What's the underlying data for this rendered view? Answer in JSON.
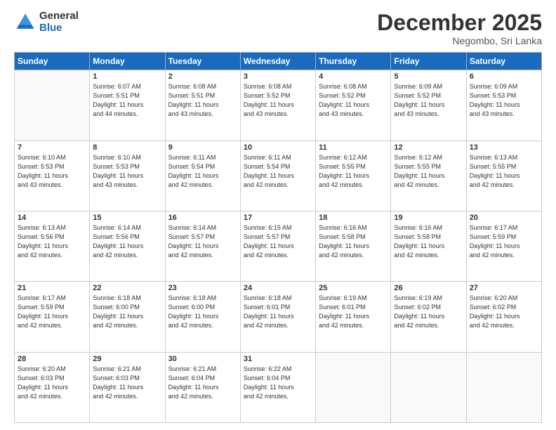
{
  "logo": {
    "general": "General",
    "blue": "Blue"
  },
  "title": "December 2025",
  "location": "Negombo, Sri Lanka",
  "days_of_week": [
    "Sunday",
    "Monday",
    "Tuesday",
    "Wednesday",
    "Thursday",
    "Friday",
    "Saturday"
  ],
  "weeks": [
    [
      {
        "day": "",
        "info": ""
      },
      {
        "day": "1",
        "info": "Sunrise: 6:07 AM\nSunset: 5:51 PM\nDaylight: 11 hours\nand 44 minutes."
      },
      {
        "day": "2",
        "info": "Sunrise: 6:08 AM\nSunset: 5:51 PM\nDaylight: 11 hours\nand 43 minutes."
      },
      {
        "day": "3",
        "info": "Sunrise: 6:08 AM\nSunset: 5:52 PM\nDaylight: 11 hours\nand 43 minutes."
      },
      {
        "day": "4",
        "info": "Sunrise: 6:08 AM\nSunset: 5:52 PM\nDaylight: 11 hours\nand 43 minutes."
      },
      {
        "day": "5",
        "info": "Sunrise: 6:09 AM\nSunset: 5:52 PM\nDaylight: 11 hours\nand 43 minutes."
      },
      {
        "day": "6",
        "info": "Sunrise: 6:09 AM\nSunset: 5:53 PM\nDaylight: 11 hours\nand 43 minutes."
      }
    ],
    [
      {
        "day": "7",
        "info": "Sunrise: 6:10 AM\nSunset: 5:53 PM\nDaylight: 11 hours\nand 43 minutes."
      },
      {
        "day": "8",
        "info": "Sunrise: 6:10 AM\nSunset: 5:53 PM\nDaylight: 11 hours\nand 43 minutes."
      },
      {
        "day": "9",
        "info": "Sunrise: 6:11 AM\nSunset: 5:54 PM\nDaylight: 11 hours\nand 42 minutes."
      },
      {
        "day": "10",
        "info": "Sunrise: 6:11 AM\nSunset: 5:54 PM\nDaylight: 11 hours\nand 42 minutes."
      },
      {
        "day": "11",
        "info": "Sunrise: 6:12 AM\nSunset: 5:55 PM\nDaylight: 11 hours\nand 42 minutes."
      },
      {
        "day": "12",
        "info": "Sunrise: 6:12 AM\nSunset: 5:55 PM\nDaylight: 11 hours\nand 42 minutes."
      },
      {
        "day": "13",
        "info": "Sunrise: 6:13 AM\nSunset: 5:55 PM\nDaylight: 11 hours\nand 42 minutes."
      }
    ],
    [
      {
        "day": "14",
        "info": "Sunrise: 6:13 AM\nSunset: 5:56 PM\nDaylight: 11 hours\nand 42 minutes."
      },
      {
        "day": "15",
        "info": "Sunrise: 6:14 AM\nSunset: 5:56 PM\nDaylight: 11 hours\nand 42 minutes."
      },
      {
        "day": "16",
        "info": "Sunrise: 6:14 AM\nSunset: 5:57 PM\nDaylight: 11 hours\nand 42 minutes."
      },
      {
        "day": "17",
        "info": "Sunrise: 6:15 AM\nSunset: 5:57 PM\nDaylight: 11 hours\nand 42 minutes."
      },
      {
        "day": "18",
        "info": "Sunrise: 6:16 AM\nSunset: 5:58 PM\nDaylight: 11 hours\nand 42 minutes."
      },
      {
        "day": "19",
        "info": "Sunrise: 6:16 AM\nSunset: 5:58 PM\nDaylight: 11 hours\nand 42 minutes."
      },
      {
        "day": "20",
        "info": "Sunrise: 6:17 AM\nSunset: 5:59 PM\nDaylight: 11 hours\nand 42 minutes."
      }
    ],
    [
      {
        "day": "21",
        "info": "Sunrise: 6:17 AM\nSunset: 5:59 PM\nDaylight: 11 hours\nand 42 minutes."
      },
      {
        "day": "22",
        "info": "Sunrise: 6:18 AM\nSunset: 6:00 PM\nDaylight: 11 hours\nand 42 minutes."
      },
      {
        "day": "23",
        "info": "Sunrise: 6:18 AM\nSunset: 6:00 PM\nDaylight: 11 hours\nand 42 minutes."
      },
      {
        "day": "24",
        "info": "Sunrise: 6:18 AM\nSunset: 6:01 PM\nDaylight: 11 hours\nand 42 minutes."
      },
      {
        "day": "25",
        "info": "Sunrise: 6:19 AM\nSunset: 6:01 PM\nDaylight: 11 hours\nand 42 minutes."
      },
      {
        "day": "26",
        "info": "Sunrise: 6:19 AM\nSunset: 6:02 PM\nDaylight: 11 hours\nand 42 minutes."
      },
      {
        "day": "27",
        "info": "Sunrise: 6:20 AM\nSunset: 6:02 PM\nDaylight: 11 hours\nand 42 minutes."
      }
    ],
    [
      {
        "day": "28",
        "info": "Sunrise: 6:20 AM\nSunset: 6:03 PM\nDaylight: 11 hours\nand 42 minutes."
      },
      {
        "day": "29",
        "info": "Sunrise: 6:21 AM\nSunset: 6:03 PM\nDaylight: 11 hours\nand 42 minutes."
      },
      {
        "day": "30",
        "info": "Sunrise: 6:21 AM\nSunset: 6:04 PM\nDaylight: 11 hours\nand 42 minutes."
      },
      {
        "day": "31",
        "info": "Sunrise: 6:22 AM\nSunset: 6:04 PM\nDaylight: 11 hours\nand 42 minutes."
      },
      {
        "day": "",
        "info": ""
      },
      {
        "day": "",
        "info": ""
      },
      {
        "day": "",
        "info": ""
      }
    ]
  ]
}
